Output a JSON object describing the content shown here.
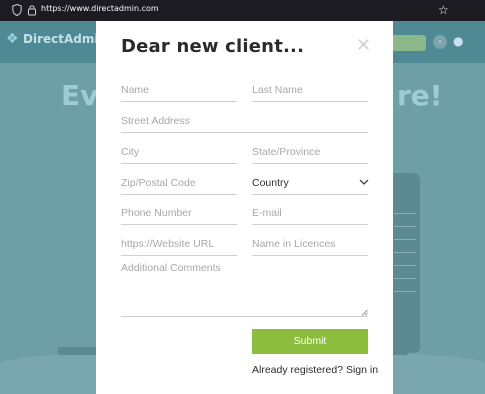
{
  "browser": {
    "url": "https://www.directadmin.com",
    "icons": [
      "shield-icon",
      "lock-icon",
      "star-icon"
    ]
  },
  "background_page": {
    "logo_text": "DirectAdmin",
    "hero_left": "Ev",
    "hero_right": "re!"
  },
  "modal": {
    "title": "Dear new client...",
    "close_icon": "close-icon",
    "fields": {
      "name": "Name",
      "last_name": "Last Name",
      "street": "Street Address",
      "city": "City",
      "state": "State/Province",
      "zip": "Zip/Postal Code",
      "country": "Country",
      "phone": "Phone Number",
      "email": "E-mail",
      "website": "https://Website URL",
      "licence_name": "Name in Licences",
      "comments": "Additional Comments"
    },
    "submit_label": "Submit",
    "signin_text": "Already registered? Sign in",
    "accent_color": "#8cbd3c"
  }
}
